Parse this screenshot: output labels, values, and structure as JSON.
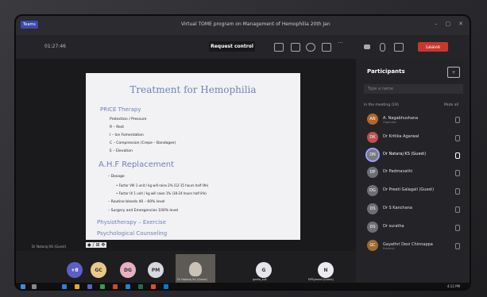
{
  "window": {
    "app_label": "Teams",
    "title": "Virtual TOME program on Management of Hemophilia 20th Jan",
    "buttons": [
      "–",
      "□",
      "✕"
    ]
  },
  "toolbar": {
    "timer": "01:27:46",
    "request_control": "Request control",
    "leave": "Leave"
  },
  "slide": {
    "title": "Treatment for Hemophilia",
    "lines": [
      "PRICE Therapy",
      "Protection / Pressure",
      "R – Rest",
      "I – Ice Fomentation",
      "C – Compression (Crepe – Bandages)",
      "E – Elevation",
      "A.H.F Replacement",
      "– Dosage",
      "• Factor VIII 1 unit / kg will raise 2% (12-15 hours half life)",
      "• Factor IX 1 unit / kg will raise 1% (18-24 hours half life)",
      "– Routine bleeds 40 – 60% level",
      "– Surgery and Emergencies 100% level",
      "Physiotherapy – Exercise",
      "Psychological Counseling"
    ],
    "presenter": "Dr Nataraj KS (Guest)",
    "tools": "◆ / ⊞ ✥"
  },
  "participants": {
    "title": "Participants",
    "search_placeholder": "Type a name",
    "section": "In the meeting (19)",
    "mute_all": "Mute all",
    "list": [
      {
        "initials": "AN",
        "name": "A. Nagabhushana",
        "sub": "Organiser",
        "color": "#b5652d"
      },
      {
        "initials": "DK",
        "name": "Dr Kritika Agarwal",
        "sub": "",
        "color": "#c05050"
      },
      {
        "initials": "DN",
        "name": "Dr Nataraj KS (Guest)",
        "sub": "",
        "color": "#7a7a84"
      },
      {
        "initials": "DP",
        "name": "Dr Padmavathi",
        "sub": "",
        "color": "#8a8a92"
      },
      {
        "initials": "DG",
        "name": "Dr Preeti Galagali (Guest)",
        "sub": "",
        "color": "#8a8a92"
      },
      {
        "initials": "DS",
        "name": "Dr S Kanchana",
        "sub": "",
        "color": "#8a8a92"
      },
      {
        "initials": "DS",
        "name": "Dr suratha",
        "sub": "",
        "color": "#8a8a92"
      },
      {
        "initials": "GC",
        "name": "Gayathri Devi Chinnappa",
        "sub": "External",
        "color": "#a06a30"
      }
    ]
  },
  "bottom": {
    "avatars": [
      {
        "initials": "+8",
        "color": "#5b5fc7"
      },
      {
        "initials": "GC",
        "color": "#e8c98a"
      },
      {
        "initials": "DG",
        "color": "#e6b0c0"
      },
      {
        "initials": "PM",
        "color": "#d8d8e0"
      },
      {
        "initials": "G",
        "color": "#e6e6ea"
      },
      {
        "initials": "N",
        "color": "#ececf0"
      }
    ],
    "video_label": "Dr Nataraj KS (Guest)",
    "g_label": "geeta_sok",
    "n_label": "NPSyeeed (Guest)"
  },
  "taskbar": {
    "time": "4:12 PM"
  }
}
